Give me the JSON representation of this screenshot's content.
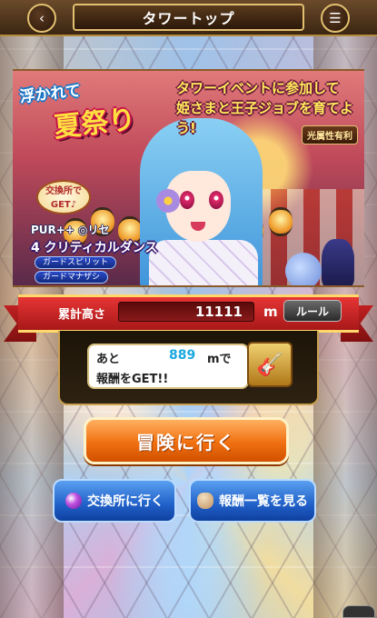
{
  "header": {
    "title": "タワートップ",
    "back_icon": "‹",
    "menu_icon": "☰"
  },
  "banner": {
    "logo_top": "浮かれて",
    "logo_main": "夏祭り",
    "event_line1": "タワーイベントに参加して",
    "event_line2": "姫さまと王子ジョブを育てよう!",
    "attribute_badge": "光属性有利",
    "exchange_label": "交換所で GET♪",
    "reward_title": "PUR++ ◎リセ",
    "reward_skill": "4 クリティカルダンス",
    "guard_items": [
      "ガードスピリット",
      "ガードマナザシ"
    ]
  },
  "tower": {
    "height_label": "累計高さ",
    "height_value": "11111",
    "height_unit": "m",
    "rule_label": "ルール"
  },
  "reward": {
    "prefix": "あと",
    "remaining": "889",
    "unit": "mで",
    "line2": "報酬をGET!!",
    "icon": "🎸"
  },
  "actions": {
    "adventure_label": "冒険に行く",
    "exchange_label": "交換所に行く",
    "reward_list_label": "報酬一覧を見る"
  },
  "colors": {
    "accent": "#f07010",
    "ribbon": "#d02828",
    "button_blue": "#2060c8"
  }
}
